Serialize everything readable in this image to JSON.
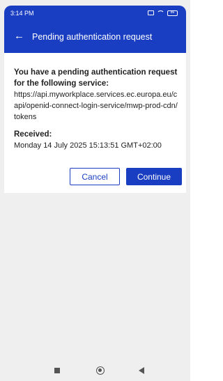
{
  "status_bar": {
    "time": "3:14 PM",
    "battery": "86",
    "icons": [
      "vibrate-icon",
      "wifi-icon",
      "battery-icon"
    ]
  },
  "app_bar": {
    "back_icon": "arrow-left-icon",
    "back_glyph": "←",
    "title": "Pending authentication request"
  },
  "request": {
    "heading": "You have a pending authentication request for the following service:",
    "service_url": "https://api.myworkplace.services.ec.europa.eu/capi/openid-connect-login-service/mwp-prod-cdn/tokens",
    "received_label": "Received:",
    "received_value": "Monday 14 July 2025 15:13:51 GMT+02:00"
  },
  "actions": {
    "cancel_label": "Cancel",
    "continue_label": "Continue"
  },
  "nav_bar": {
    "icons": [
      "recents-icon",
      "home-icon",
      "back-icon"
    ]
  },
  "colors": {
    "brand": "#1a3ec2",
    "background": "#efeff0",
    "card": "#ffffff"
  }
}
